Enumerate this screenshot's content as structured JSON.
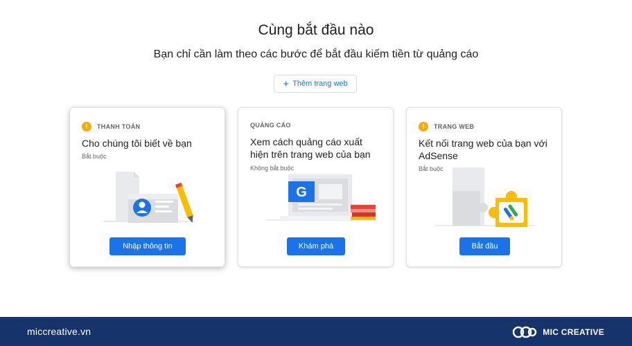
{
  "header": {
    "title": "Cùng bắt đầu nào",
    "subtitle": "Bạn chỉ cần làm theo các bước để bắt đầu kiếm tiền từ quảng cáo",
    "add_site_label": "Thêm trang web",
    "add_site_icon": "plus-icon"
  },
  "cards": [
    {
      "tag": "THANH TOÁN",
      "has_warning": true,
      "title": "Cho chúng tôi biết về bạn",
      "note": "Bắt buộc",
      "button": "Nhập thông tin"
    },
    {
      "tag": "QUẢNG CÁO",
      "has_warning": false,
      "title": "Xem cách quảng cáo xuất hiện trên trang web của bạn",
      "note": "Không bắt buộc",
      "button": "Khám phá"
    },
    {
      "tag": "TRANG WEB",
      "has_warning": true,
      "title": "Kết nối trang web của bạn với AdSense",
      "note": "Bắt buộc",
      "button": "Bắt đầu"
    }
  ],
  "footer": {
    "site": "miccreative.vn",
    "brand": "MIC CREATIVE"
  },
  "colors": {
    "primary_blue": "#1a73e8",
    "warning_yellow": "#f9ab00",
    "footer_navy": "#17336b"
  }
}
